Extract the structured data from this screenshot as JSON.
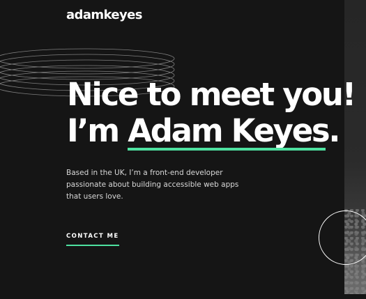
{
  "header": {
    "logo": "adamkeyes"
  },
  "hero": {
    "headline_line1": "Nice to meet you!",
    "headline_prefix": "I’m ",
    "headline_name": "Adam Keyes",
    "headline_suffix": ".",
    "bio": "Based in the UK, I’m a front-end developer passionate about building accessible web apps that users love.",
    "cta_label": "CONTACT ME"
  },
  "colors": {
    "background": "#151515",
    "accent": "#4ee1a0",
    "text": "#ffffff",
    "muted_text": "#d9d9d9"
  }
}
